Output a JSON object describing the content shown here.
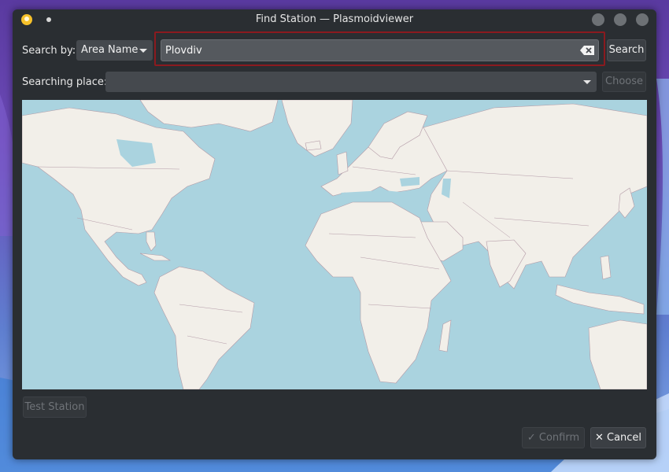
{
  "window": {
    "title": "Find Station — Plasmoidviewer"
  },
  "search_row": {
    "label": "Search by:",
    "mode_value": "Area Name",
    "query_value": "Plovdiv",
    "search_button": "Search"
  },
  "place_row": {
    "label": "Searching place:",
    "place_value": "",
    "choose_button": "Choose"
  },
  "buttons": {
    "test_station": "Test Station",
    "confirm": "Confirm",
    "cancel": "Cancel",
    "confirm_icon": "✓",
    "cancel_icon": "✕"
  },
  "colors": {
    "window_bg": "#2a2e32",
    "water": "#aad3df",
    "land": "#f2efe9",
    "border": "#b39aa6",
    "highlight": "#8b1a1f"
  },
  "icons": [
    "app-icon",
    "pin-icon",
    "window-button-icon",
    "chevron-down-icon",
    "clear-icon",
    "checkmark-icon",
    "close-icon"
  ]
}
